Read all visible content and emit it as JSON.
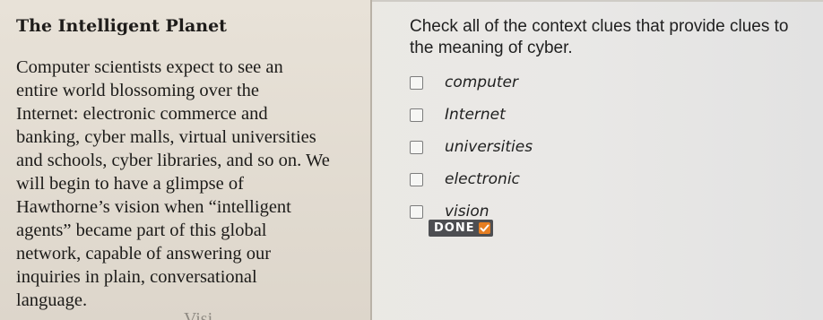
{
  "passage": {
    "title": "The Intelligent Planet",
    "lines": [
      "Computer scientists expect to see an",
      "entire world blossoming over the",
      "Internet: electronic commerce and",
      "banking, cyber malls, virtual universities",
      "and schools, cyber libraries, and so on. We",
      "will begin to have a glimpse of",
      "Hawthorne’s vision when “intelligent",
      "agents” became part of this global",
      "network, capable of answering our",
      "inquiries in plain, conversational",
      "language."
    ],
    "cutoff_text": "Visi"
  },
  "question": {
    "prompt_lines": [
      "Check all of the context clues that provide clues to",
      "the meaning of cyber."
    ],
    "options": [
      {
        "label": "computer",
        "checked": false
      },
      {
        "label": "Internet",
        "checked": false
      },
      {
        "label": "universities",
        "checked": false
      },
      {
        "label": "electronic",
        "checked": false
      },
      {
        "label": "vision",
        "checked": false
      }
    ],
    "done_label": "DONE",
    "done_check_icon": "checkmark-icon"
  },
  "colors": {
    "done_bg": "#4d4e52",
    "done_check": "#e67e22"
  }
}
